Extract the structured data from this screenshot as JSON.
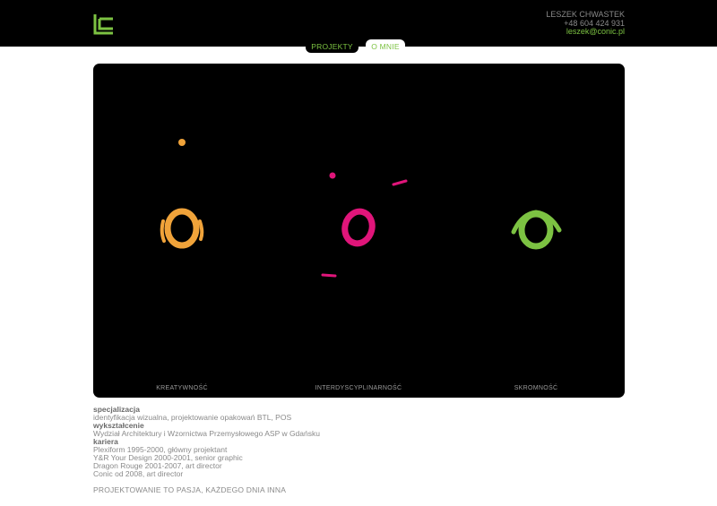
{
  "header": {
    "name": "LESZEK CHWASTEK",
    "phone": "+48 604 424 931",
    "email": "leszek@conic.pl"
  },
  "tabs": [
    {
      "label": "PROJEKTY"
    },
    {
      "label": "O MNIE"
    }
  ],
  "panel": {
    "captions": [
      "KREATYWNOŚĆ",
      "INTERDYSCYPLINARNOŚĆ",
      "SKROMNOŚĆ"
    ]
  },
  "info": {
    "specjalizacja_head": "specjalizacja",
    "specjalizacja": "identyfikacja wizualna, projektowanie opakowań BTL, POS",
    "wyksztalcenie_head": "wykształcenie",
    "wyksztalcenie": "Wydział Architektury i Wzornictwa Przemysłowego ASP w Gdańsku",
    "kariera_head": "kariera",
    "kariera": [
      "Plexiform 1995-2000, główny projektant",
      "Y&R Your Design 2000-2001, senior graphic",
      "Dragon Rouge 2001-2007, art director",
      "Conic od 2008, art director"
    ],
    "motto": "PROJEKTOWANIE TO PASJA, KAŻDEGO DNIA INNA"
  },
  "colors": {
    "accent": "#7cc242",
    "orange": "#f0a33a",
    "magenta": "#e0157a",
    "green": "#7cc242"
  }
}
